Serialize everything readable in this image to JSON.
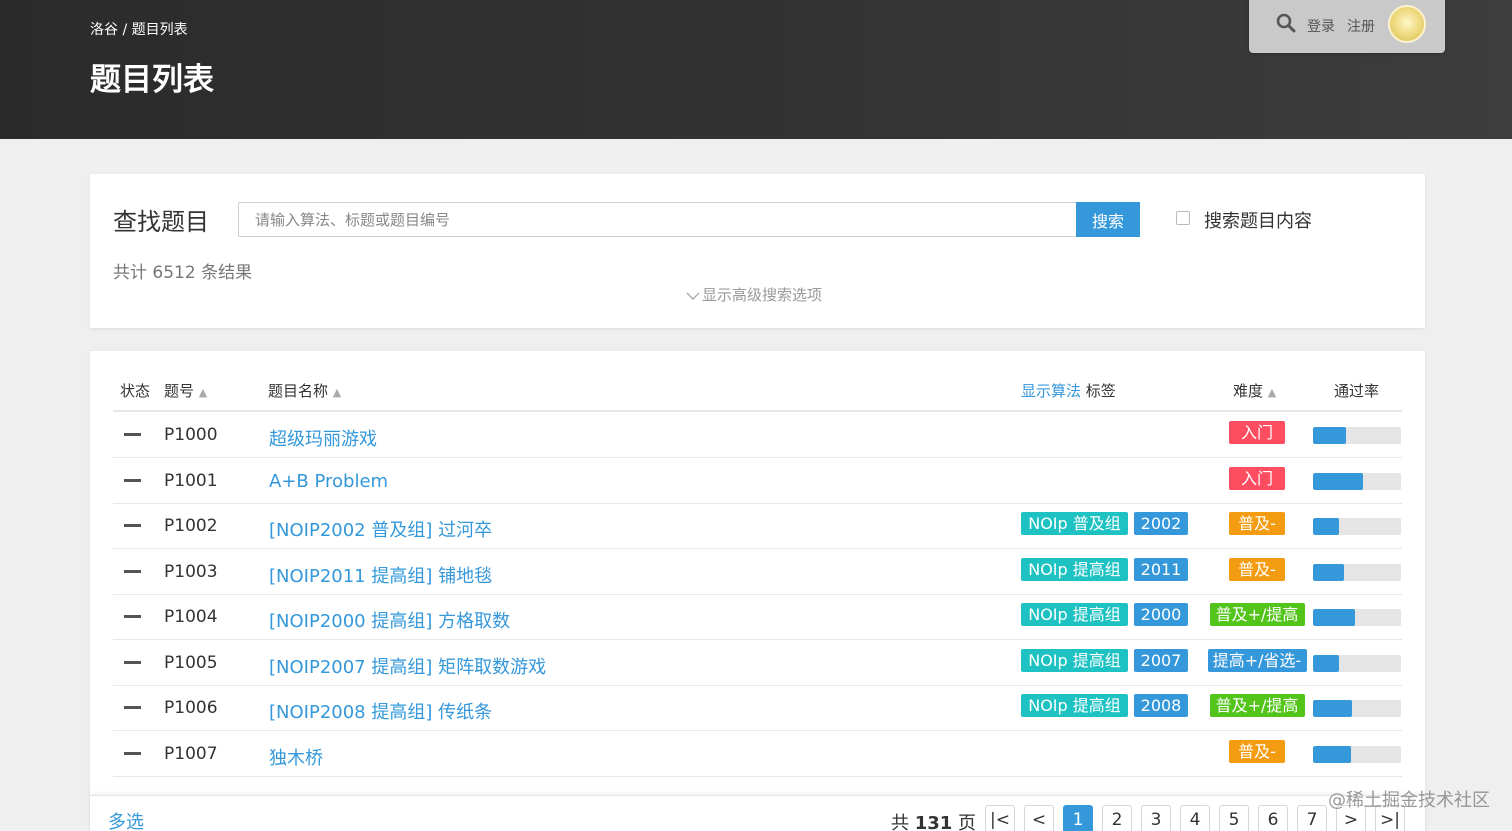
{
  "header": {
    "breadcrumb": "洛谷 / 题目列表",
    "title": "题目列表",
    "login": "登录",
    "register": "注册"
  },
  "search": {
    "title": "查找题目",
    "placeholder": "请输入算法、标题或题目编号",
    "button": "搜索",
    "content_option": "搜索题目内容",
    "content_checked": false,
    "result_count": "共计 6512 条结果",
    "advanced": "显示高级搜索选项"
  },
  "table": {
    "headers": {
      "status": "状态",
      "pid": "题号",
      "name": "题目名称",
      "show_algo": "显示算法",
      "tags": "标签",
      "difficulty": "难度",
      "pass_rate": "通过率"
    },
    "rows": [
      {
        "pid": "P1000",
        "name": "超级玛丽游戏",
        "tag_contest": "",
        "tag_year": "",
        "difficulty": "入门",
        "diff_color": "#fe4c61",
        "pass": 0.38
      },
      {
        "pid": "P1001",
        "name": "A+B Problem",
        "tag_contest": "",
        "tag_year": "",
        "difficulty": "入门",
        "diff_color": "#fe4c61",
        "pass": 0.57
      },
      {
        "pid": "P1002",
        "name": "[NOIP2002 普及组] 过河卒",
        "tag_contest": "NOIp 普及组",
        "tag_year": "2002",
        "difficulty": "普及-",
        "diff_color": "#f39c11",
        "pass": 0.29
      },
      {
        "pid": "P1003",
        "name": "[NOIP2011 提高组] 铺地毯",
        "tag_contest": "NOIp 提高组",
        "tag_year": "2011",
        "difficulty": "普及-",
        "diff_color": "#f39c11",
        "pass": 0.35
      },
      {
        "pid": "P1004",
        "name": "[NOIP2000 提高组] 方格取数",
        "tag_contest": "NOIp 提高组",
        "tag_year": "2000",
        "difficulty": "普及+/提高",
        "diff_color": "#52c41a",
        "pass": 0.48
      },
      {
        "pid": "P1005",
        "name": "[NOIP2007 提高组] 矩阵取数游戏",
        "tag_contest": "NOIp 提高组",
        "tag_year": "2007",
        "difficulty": "提高+/省选-",
        "diff_color": "#3498db",
        "pass": 0.29
      },
      {
        "pid": "P1006",
        "name": "[NOIP2008 提高组] 传纸条",
        "tag_contest": "NOIp 提高组",
        "tag_year": "2008",
        "difficulty": "普及+/提高",
        "diff_color": "#52c41a",
        "pass": 0.44
      },
      {
        "pid": "P1007",
        "name": "独木桥",
        "tag_contest": "",
        "tag_year": "",
        "difficulty": "普及-",
        "diff_color": "#f39c11",
        "pass": 0.43
      }
    ]
  },
  "footer": {
    "multi_select": "多选",
    "total_prefix": "共",
    "total_pages": "131",
    "total_suffix": "页",
    "first_page": "|<",
    "prev_page": "<",
    "pages": [
      "1",
      "2",
      "3",
      "4",
      "5",
      "6",
      "7"
    ],
    "current_page": "1",
    "next_page": ">",
    "last_page": ">|"
  },
  "watermark": "@稀土掘金技术社区",
  "colors": {
    "accent": "#3498db",
    "tag_contest": "#1ec2c2",
    "header_bg": "#333333"
  }
}
